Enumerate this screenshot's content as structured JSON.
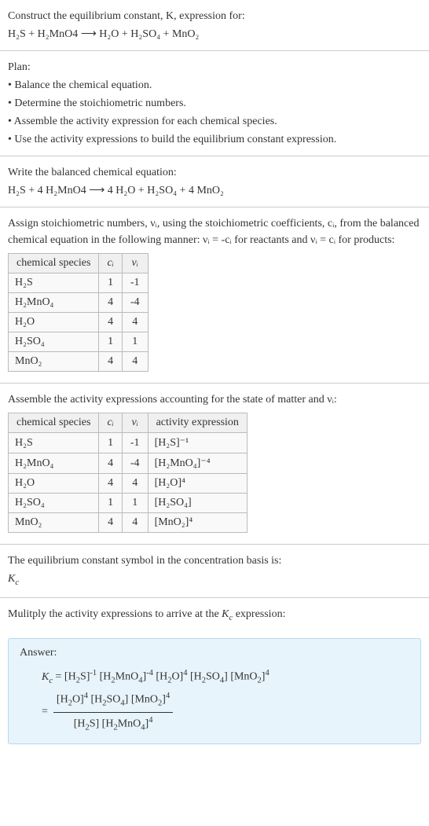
{
  "header": {
    "line1": "Construct the equilibrium constant, K, expression for:",
    "equation": "H₂S + H₂MnO4 ⟶ H₂O + H₂SO₄ + MnO₂"
  },
  "plan": {
    "title": "Plan:",
    "items": [
      "• Balance the chemical equation.",
      "• Determine the stoichiometric numbers.",
      "• Assemble the activity expression for each chemical species.",
      "• Use the activity expressions to build the equilibrium constant expression."
    ]
  },
  "balanced": {
    "intro": "Write the balanced chemical equation:",
    "equation": "H₂S + 4 H₂MnO4 ⟶ 4 H₂O + H₂SO₄ + 4 MnO₂"
  },
  "assign": {
    "text": "Assign stoichiometric numbers, νᵢ, using the stoichiometric coefficients, cᵢ, from the balanced chemical equation in the following manner: νᵢ = -cᵢ for reactants and νᵢ = cᵢ for products:",
    "table": {
      "headers": [
        "chemical species",
        "cᵢ",
        "νᵢ"
      ],
      "rows": [
        [
          "H₂S",
          "1",
          "-1"
        ],
        [
          "H₂MnO₄",
          "4",
          "-4"
        ],
        [
          "H₂O",
          "4",
          "4"
        ],
        [
          "H₂SO₄",
          "1",
          "1"
        ],
        [
          "MnO₂",
          "4",
          "4"
        ]
      ]
    }
  },
  "assemble": {
    "text": "Assemble the activity expressions accounting for the state of matter and νᵢ:",
    "table": {
      "headers": [
        "chemical species",
        "cᵢ",
        "νᵢ",
        "activity expression"
      ],
      "rows": [
        [
          "H₂S",
          "1",
          "-1",
          "[H₂S]⁻¹"
        ],
        [
          "H₂MnO₄",
          "4",
          "-4",
          "[H₂MnO₄]⁻⁴"
        ],
        [
          "H₂O",
          "4",
          "4",
          "[H₂O]⁴"
        ],
        [
          "H₂SO₄",
          "1",
          "1",
          "[H₂SO₄]"
        ],
        [
          "MnO₂",
          "4",
          "4",
          "[MnO₂]⁴"
        ]
      ]
    }
  },
  "symbol": {
    "line1": "The equilibrium constant symbol in the concentration basis is:",
    "line2": "K_c"
  },
  "multiply": {
    "text": "Mulitply the activity expressions to arrive at the K_c expression:"
  },
  "answer": {
    "label": "Answer:",
    "eq1": "K_c = [H₂S]⁻¹ [H₂MnO₄]⁻⁴ [H₂O]⁴ [H₂SO₄] [MnO₂]⁴",
    "frac_num": "[H₂O]⁴ [H₂SO₄] [MnO₂]⁴",
    "frac_den": "[H₂S] [H₂MnO₄]⁴"
  },
  "chart_data": {
    "type": "table",
    "tables": [
      {
        "title": "Stoichiometric numbers",
        "columns": [
          "chemical species",
          "c_i",
          "ν_i"
        ],
        "rows": [
          {
            "species": "H2S",
            "c_i": 1,
            "nu_i": -1
          },
          {
            "species": "H2MnO4",
            "c_i": 4,
            "nu_i": -4
          },
          {
            "species": "H2O",
            "c_i": 4,
            "nu_i": 4
          },
          {
            "species": "H2SO4",
            "c_i": 1,
            "nu_i": 1
          },
          {
            "species": "MnO2",
            "c_i": 4,
            "nu_i": 4
          }
        ]
      },
      {
        "title": "Activity expressions",
        "columns": [
          "chemical species",
          "c_i",
          "ν_i",
          "activity expression"
        ],
        "rows": [
          {
            "species": "H2S",
            "c_i": 1,
            "nu_i": -1,
            "activity": "[H2S]^-1"
          },
          {
            "species": "H2MnO4",
            "c_i": 4,
            "nu_i": -4,
            "activity": "[H2MnO4]^-4"
          },
          {
            "species": "H2O",
            "c_i": 4,
            "nu_i": 4,
            "activity": "[H2O]^4"
          },
          {
            "species": "H2SO4",
            "c_i": 1,
            "nu_i": 1,
            "activity": "[H2SO4]"
          },
          {
            "species": "MnO2",
            "c_i": 4,
            "nu_i": 4,
            "activity": "[MnO2]^4"
          }
        ]
      }
    ]
  }
}
